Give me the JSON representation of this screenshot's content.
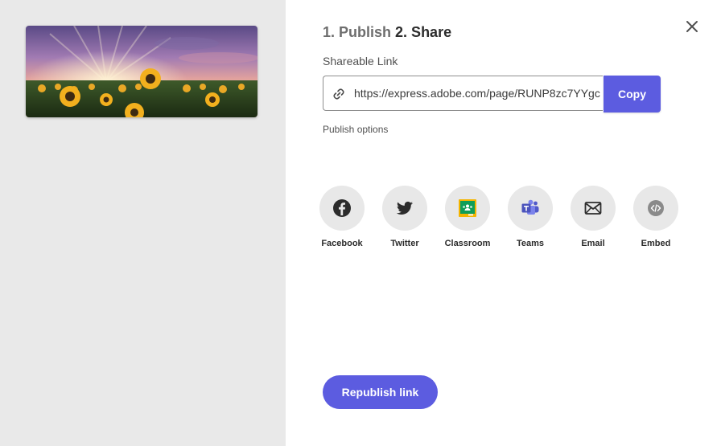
{
  "heading": {
    "step1": "1. Publish",
    "step2": "2. Share"
  },
  "link": {
    "label": "Shareable Link",
    "url": "https://express.adobe.com/page/RUNP8zc7YYgc",
    "copy_label": "Copy"
  },
  "publish_options_label": "Publish options",
  "share_targets": [
    {
      "label": "Facebook",
      "icon": "facebook-icon"
    },
    {
      "label": "Twitter",
      "icon": "twitter-icon"
    },
    {
      "label": "Classroom",
      "icon": "google-classroom-icon"
    },
    {
      "label": "Teams",
      "icon": "microsoft-teams-icon"
    },
    {
      "label": "Email",
      "icon": "email-icon"
    },
    {
      "label": "Embed",
      "icon": "embed-code-icon"
    }
  ],
  "republish_label": "Republish link",
  "colors": {
    "accent": "#5c5ce0",
    "left_pane": "#e9e9e9",
    "icon_circle": "#e8e8e8"
  }
}
